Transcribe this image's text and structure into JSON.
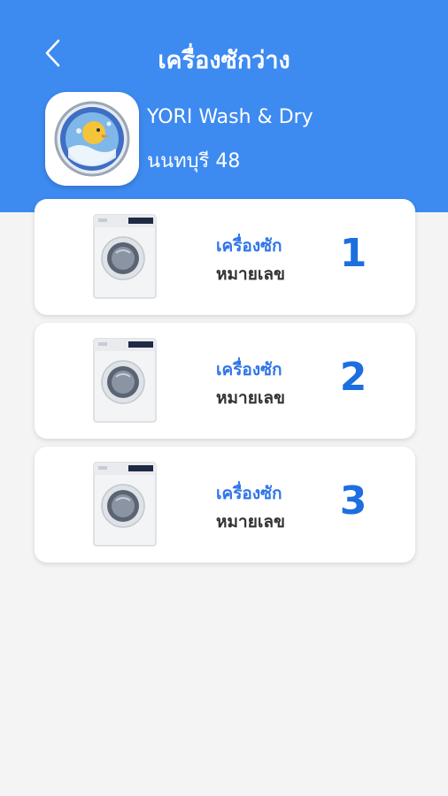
{
  "header": {
    "title": "เครื่องซักว่าง",
    "back_icon": "chevron-left-icon",
    "background": "#3d8af0"
  },
  "shop": {
    "name": "YORI Wash & Dry",
    "branch": "นนทบุรี 48",
    "logo_icon": "washing-machine-logo-icon"
  },
  "machines": [
    {
      "label": "เครื่องซัก",
      "sub_label": "หมายเลข",
      "number": "1",
      "icon": "washing-machine-icon"
    },
    {
      "label": "เครื่องซัก",
      "sub_label": "หมายเลข",
      "number": "2",
      "icon": "washing-machine-icon"
    },
    {
      "label": "เครื่องซัก",
      "sub_label": "หมายเลข",
      "number": "3",
      "icon": "washing-machine-icon"
    }
  ],
  "colors": {
    "accent": "#2f74e8",
    "number": "#1d6fe0",
    "background": "#f4f4f4"
  }
}
